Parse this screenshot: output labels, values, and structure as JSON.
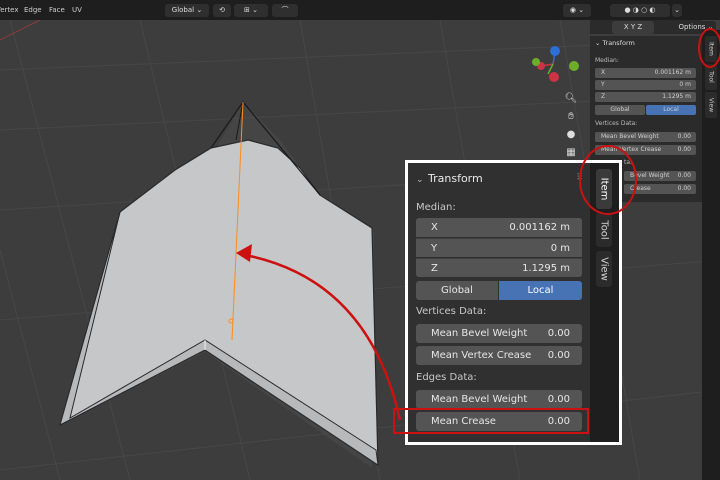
{
  "header": {
    "menus": [
      "Vertex",
      "Edge",
      "Face",
      "UV"
    ],
    "transform_orientation": "Global",
    "options_label": "Options"
  },
  "colors": {
    "accent_blue": "#4772b3",
    "annotation_red": "#cc1111",
    "mesh_face": "#c8c8c8",
    "selected_edge": "#ff8c1a"
  },
  "small_panel": {
    "title": "Transform",
    "median_label": "Median:",
    "x_label": "X",
    "x_value": "0.001162 m",
    "y_label": "Y",
    "y_value": "0 m",
    "z_label": "Z",
    "z_value": "1.1295 m",
    "global_label": "Global",
    "local_label": "Local",
    "vertices_label": "Vertices Data:",
    "mean_bevel_weight_label": "Mean Bevel Weight",
    "mean_bevel_weight_value": "0.00",
    "mean_vertex_crease_label": "Mean Vertex Crease",
    "mean_vertex_crease_value": "0.00",
    "edges_label": "ta:",
    "edge_bevel_label": "Bevel Weight",
    "edge_bevel_value": "0.00",
    "edge_crease_label": "Crease",
    "edge_crease_value": "0.00",
    "tabs": [
      "Item",
      "Tool",
      "View"
    ]
  },
  "zoom_panel": {
    "title": "Transform",
    "median_label": "Median:",
    "x_label": "X",
    "x_value": "0.001162 m",
    "y_label": "Y",
    "y_value": "0 m",
    "z_label": "Z",
    "z_value": "1.1295 m",
    "global_label": "Global",
    "local_label": "Local",
    "vertices_label": "Vertices Data:",
    "mean_bevel_weight_label": "Mean Bevel Weight",
    "mean_bevel_weight_value": "0.00",
    "mean_vertex_crease_label": "Mean Vertex Crease",
    "mean_vertex_crease_value": "0.00",
    "edges_label": "Edges Data:",
    "edge_bevel_label": "Mean Bevel Weight",
    "edge_bevel_value": "0.00",
    "edge_crease_label": "Mean Crease",
    "edge_crease_value": "0.00",
    "tabs": [
      "Item",
      "Tool",
      "View"
    ]
  },
  "icons": [
    "zoom-icon",
    "hand-pan-icon",
    "camera-icon",
    "grid-icon",
    "navigation-gizmo-icon"
  ]
}
